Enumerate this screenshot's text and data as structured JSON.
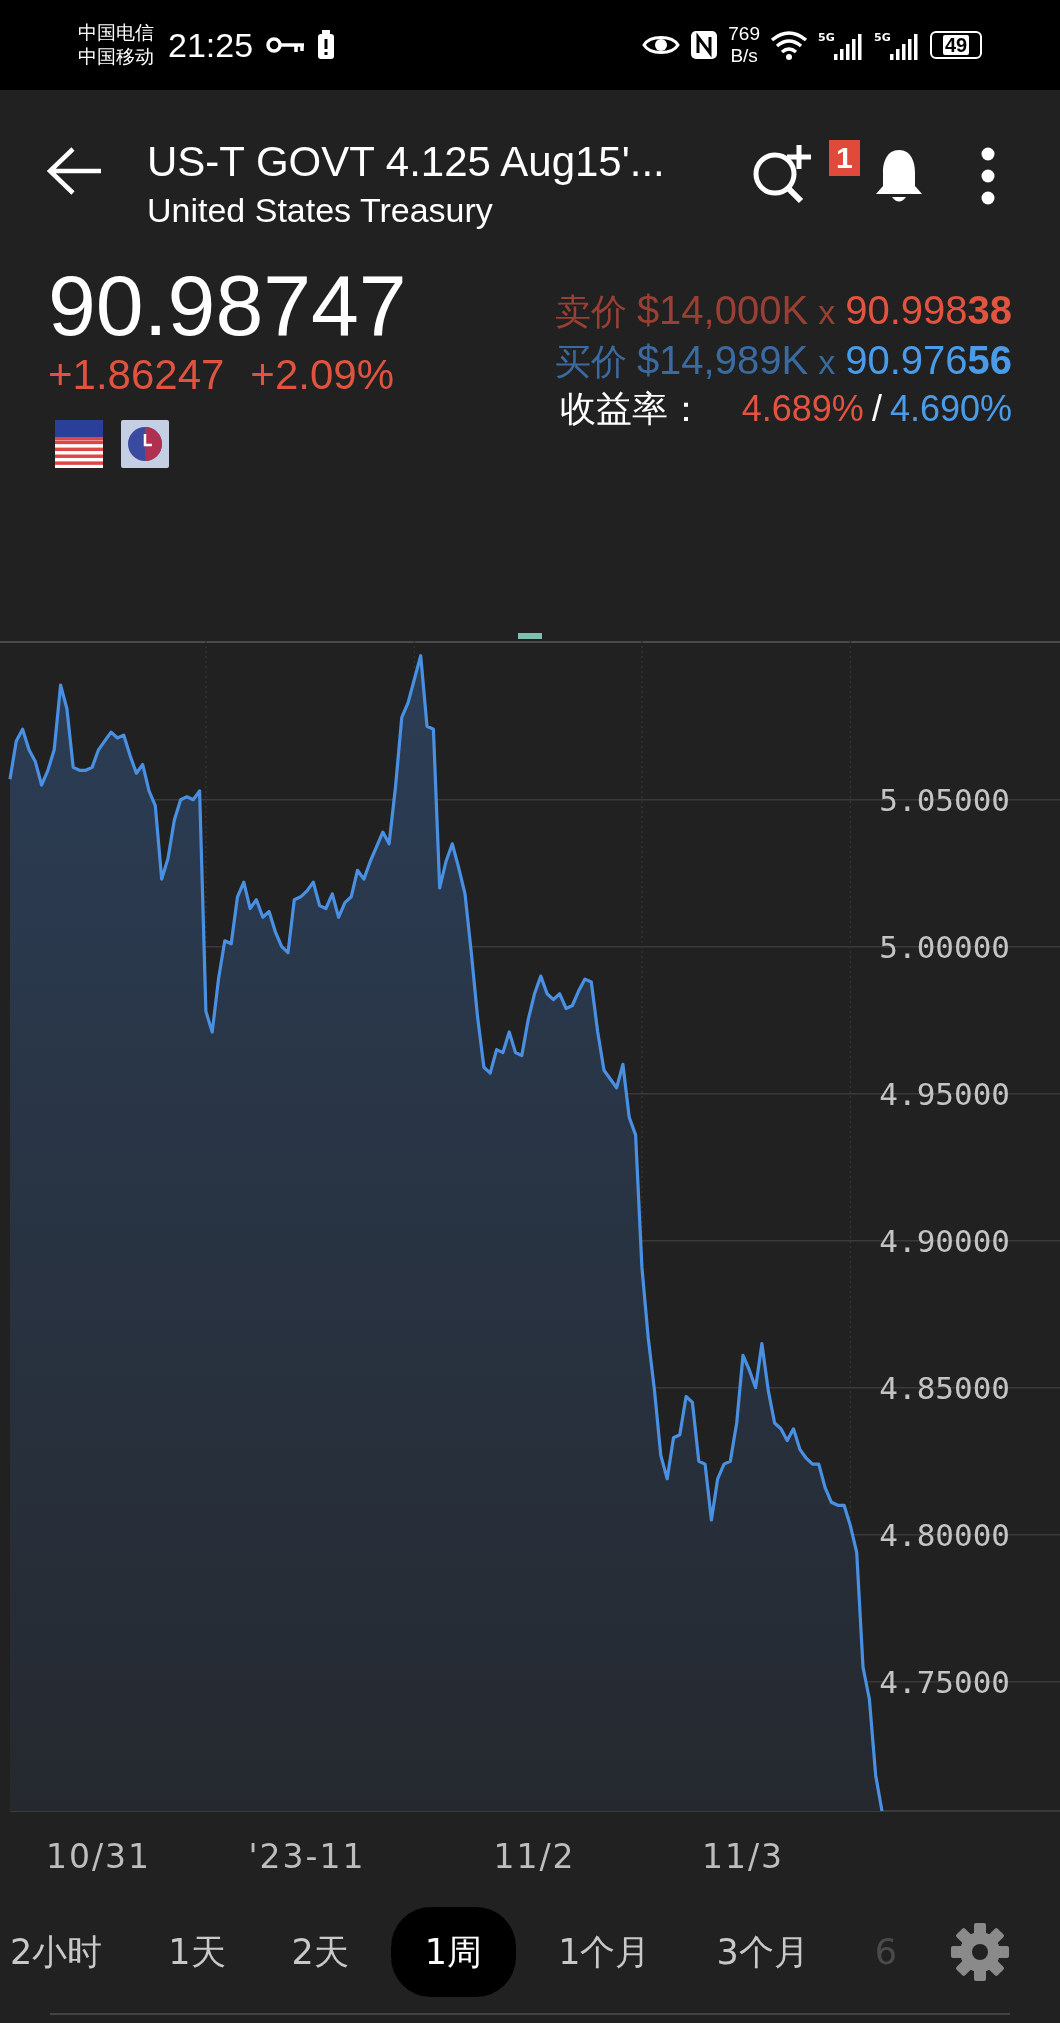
{
  "status_bar": {
    "carriers": [
      "中国电信",
      "中国移动"
    ],
    "network_types": [
      "5G",
      "5G"
    ],
    "time": "21:25",
    "net_speed": "769",
    "net_unit": "B/s",
    "battery": "49"
  },
  "header": {
    "title": "US-T GOVT 4.125 Aug15'...",
    "subtitle": "United States Treasury",
    "alert_count": "1"
  },
  "quote": {
    "price": "90.98747",
    "change": "+1.86247",
    "change_pct": "+2.09%",
    "ask": {
      "label": "卖价",
      "size": "$14,000K",
      "times": "x",
      "price": "90.998**38**"
    },
    "bid": {
      "label": "买价",
      "size": "$14,989K",
      "times": "x",
      "price": "90.976**56**"
    },
    "yield": {
      "label": "收益率：",
      "ask": "4.689%",
      "sep": "/",
      "bid": "4.690%"
    }
  },
  "chart": {
    "chart_data": {
      "type": "area",
      "grid": true,
      "ylim": [
        4.706,
        5.104
      ],
      "categories": [
        null,
        null,
        null,
        null,
        null,
        null,
        null,
        null,
        null,
        null,
        null,
        null,
        null,
        null,
        "10/31",
        null,
        null,
        null,
        null,
        null,
        null,
        null,
        null,
        null,
        null,
        null,
        null,
        null,
        null,
        null,
        null,
        null,
        null,
        null,
        null,
        null,
        null,
        null,
        null,
        null,
        null,
        null,
        null,
        null,
        null,
        null,
        null,
        "'23-11",
        null,
        null,
        null,
        null,
        null,
        null,
        null,
        null,
        null,
        null,
        null,
        null,
        null,
        null,
        null,
        null,
        null,
        null,
        null,
        null,
        null,
        null,
        null,
        null,
        null,
        null,
        null,
        null,
        null,
        null,
        null,
        null,
        null,
        null,
        null,
        "11/2",
        null,
        null,
        null,
        null,
        null,
        null,
        null,
        null,
        null,
        null,
        null,
        null,
        null,
        null,
        null,
        null,
        null,
        null,
        null,
        null,
        null,
        null,
        null,
        null,
        null,
        null,
        null,
        null,
        null,
        null,
        null,
        null,
        "11/3",
        null,
        null,
        null,
        null,
        null,
        null,
        null,
        null,
        null,
        null,
        null,
        null,
        null,
        null,
        null,
        null,
        null,
        null,
        null,
        null,
        null,
        null
      ],
      "yticks": [
        {
          "value": 5.05,
          "label": "5.05000"
        },
        {
          "value": 5.0,
          "label": "5.00000"
        },
        {
          "value": 4.95,
          "label": "4.95000"
        },
        {
          "value": 4.9,
          "label": "4.90000"
        },
        {
          "value": 4.85,
          "label": "4.85000"
        },
        {
          "value": 4.8,
          "label": "4.80000"
        },
        {
          "value": 4.75,
          "label": "4.75000"
        }
      ],
      "series": [
        {
          "color": "#4a90e2",
          "values": [
            5.057,
            5.07,
            5.074,
            5.067,
            5.063,
            5.055,
            5.06,
            5.067,
            5.089,
            5.081,
            5.061,
            5.06,
            5.06,
            5.061,
            5.067,
            5.07,
            5.073,
            5.071,
            5.072,
            5.065,
            5.059,
            5.062,
            5.053,
            5.048,
            5.023,
            5.03,
            5.043,
            5.05,
            5.051,
            5.05,
            5.053,
            4.978,
            4.971,
            4.989,
            5.002,
            5.001,
            5.017,
            5.022,
            5.013,
            5.016,
            5.01,
            5.012,
            5.005,
            5.0,
            4.998,
            5.016,
            5.017,
            5.019,
            5.022,
            5.014,
            5.013,
            5.018,
            5.01,
            5.015,
            5.017,
            5.026,
            5.023,
            5.029,
            5.034,
            5.039,
            5.035,
            5.054,
            5.078,
            5.083,
            5.091,
            5.099,
            5.075,
            5.074,
            5.02,
            5.029,
            5.035,
            5.027,
            5.018,
            4.998,
            4.976,
            4.959,
            4.957,
            4.965,
            4.964,
            4.971,
            4.964,
            4.963,
            4.975,
            4.984,
            4.99,
            4.984,
            4.982,
            4.984,
            4.979,
            4.98,
            4.985,
            4.989,
            4.988,
            4.971,
            4.958,
            4.955,
            4.952,
            4.96,
            4.942,
            4.936,
            4.891,
            4.867,
            4.849,
            4.827,
            4.819,
            4.833,
            4.834,
            4.847,
            4.845,
            4.825,
            4.824,
            4.805,
            4.819,
            4.824,
            4.825,
            4.838,
            4.861,
            4.856,
            4.85,
            4.865,
            4.849,
            4.838,
            4.836,
            4.832,
            4.836,
            4.829,
            4.826,
            4.824,
            4.824,
            4.816,
            4.811,
            4.81,
            4.81,
            4.803,
            4.794,
            4.755,
            4.744,
            4.718,
            4.706
          ]
        }
      ]
    }
  },
  "periods": [
    {
      "label": "2小时",
      "selected": false,
      "cut_off": false
    },
    {
      "label": "1天",
      "selected": false,
      "cut_off": false
    },
    {
      "label": "2天",
      "selected": false,
      "cut_off": false
    },
    {
      "label": "1周",
      "selected": true,
      "cut_off": false
    },
    {
      "label": "1个月",
      "selected": false,
      "cut_off": false
    },
    {
      "label": "3个月",
      "selected": false,
      "cut_off": false
    },
    {
      "label": "6",
      "selected": false,
      "cut_off": true
    }
  ]
}
